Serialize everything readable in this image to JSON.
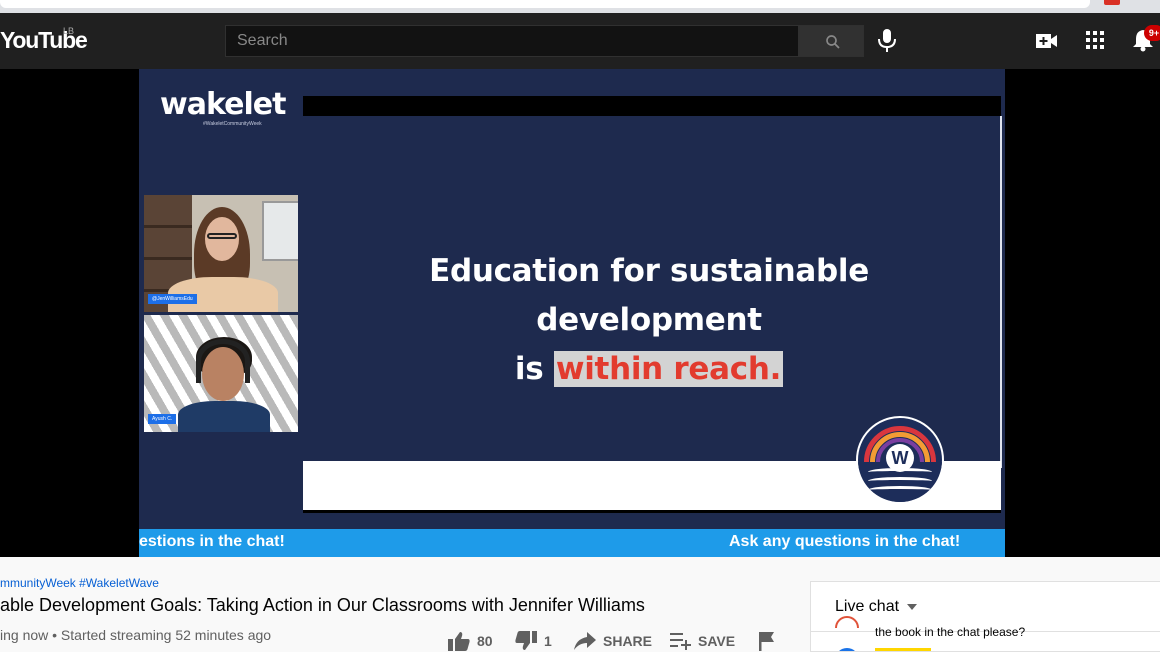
{
  "masthead": {
    "logo": "YouTube",
    "country_code": "LB",
    "search_placeholder": "Search",
    "notification_count": "9+"
  },
  "video": {
    "slide": {
      "brand": "wakelet",
      "brand_tag": "#WakeletCommunityWeek",
      "line1": "Education for sustainable development",
      "line2_prefix": "is ",
      "line2_highlight": "within reach.",
      "badge_letter": "W",
      "ticker_left": "estions in the chat!",
      "ticker_right": "Ask any questions in the chat!",
      "participant1_tag": "@JenWilliamsEdu",
      "participant2_tag": "Ayush C."
    }
  },
  "info": {
    "hashtags": "mmunityWeek #WakeletWave",
    "title": "able Development Goals: Taking Action in Our Classrooms with Jennifer Williams",
    "meta": "ing now • Started streaming 52 minutes ago",
    "like_count": "80",
    "dislike_count": "1",
    "share_label": "SHARE",
    "save_label": "SAVE"
  },
  "chat": {
    "title": "Live chat",
    "message": "the book in the chat please?"
  },
  "colors": {
    "masthead_bg": "#202020",
    "slide_bg": "#1e2a4e",
    "ticker_bg": "#1e9be9",
    "highlight_text": "#e23b2e",
    "link": "#065fd4"
  }
}
